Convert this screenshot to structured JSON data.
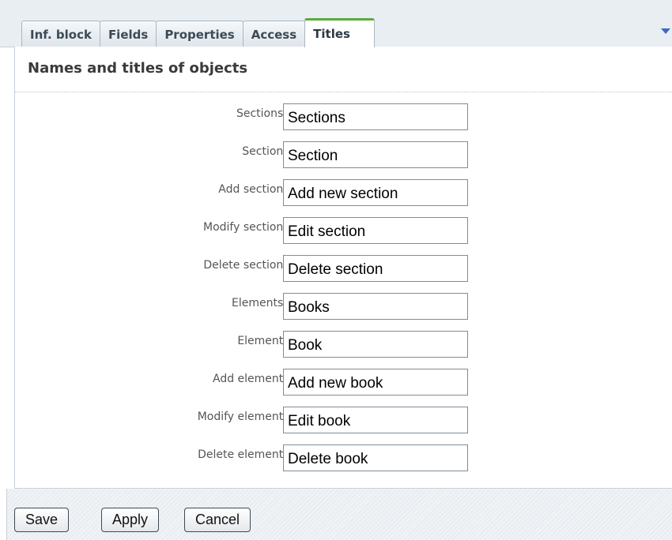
{
  "tabs": [
    {
      "label": "Inf. block",
      "active": false
    },
    {
      "label": "Fields",
      "active": false
    },
    {
      "label": "Properties",
      "active": false
    },
    {
      "label": "Access",
      "active": false
    },
    {
      "label": "Titles",
      "active": true
    }
  ],
  "tabs_menu_icon": "triangle-down-icon",
  "panel": {
    "heading": "Names and titles of objects"
  },
  "form": {
    "fields": [
      {
        "label": "Sections:",
        "value": "Sections"
      },
      {
        "label": "Section:",
        "value": "Section"
      },
      {
        "label": "Add section:",
        "value": "Add new section"
      },
      {
        "label": "Modify section:",
        "value": "Edit section"
      },
      {
        "label": "Delete section:",
        "value": "Delete section"
      },
      {
        "label": "Elements:",
        "value": "Books"
      },
      {
        "label": "Element:",
        "value": "Book"
      },
      {
        "label": "Add element:",
        "value": "Add new book"
      },
      {
        "label": "Modify element:",
        "value": "Edit book"
      },
      {
        "label": "Delete element:",
        "value": "Delete book"
      }
    ]
  },
  "buttons": {
    "save": "Save",
    "apply": "Apply",
    "cancel": "Cancel"
  },
  "colors": {
    "active_tab_accent": "#5aaa3c",
    "menu_arrow": "#3b6bc2"
  }
}
